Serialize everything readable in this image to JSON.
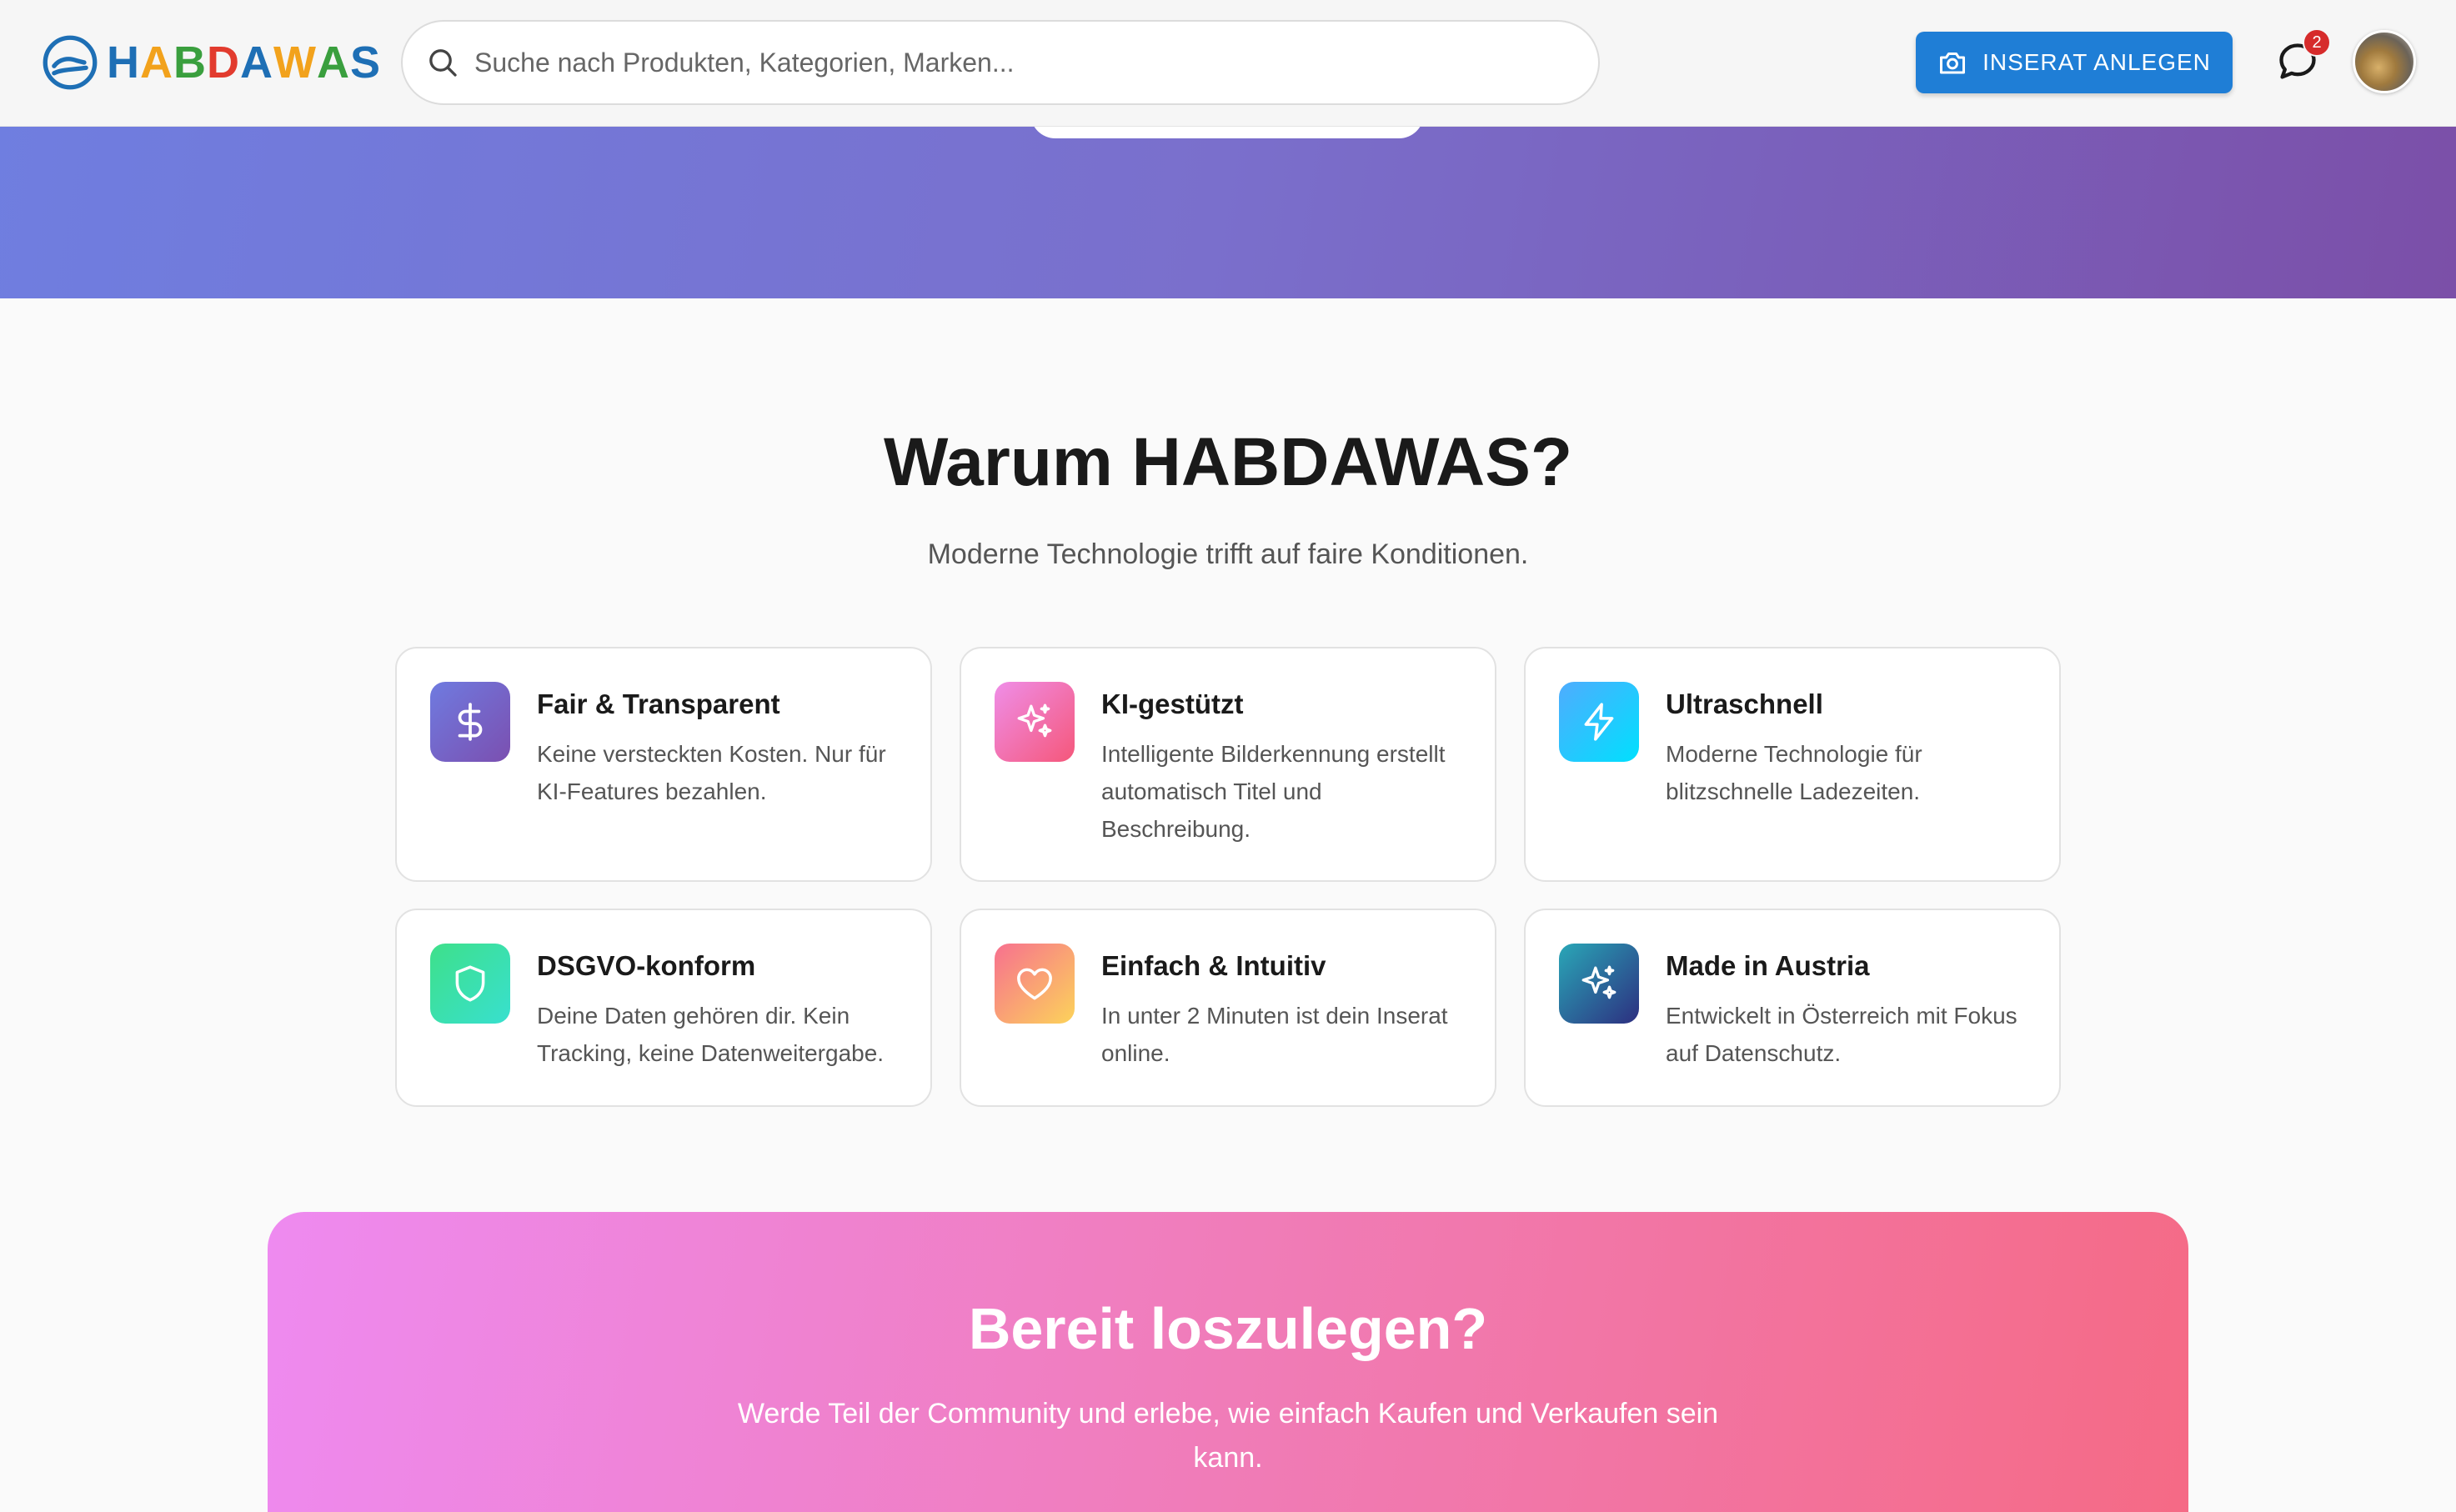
{
  "brand": {
    "letters": [
      "H",
      "A",
      "B",
      "D",
      "A",
      "W",
      "A",
      "S"
    ],
    "letter_colors": [
      "#1e6fb5",
      "#f2a21c",
      "#3a9f3e",
      "#e23b2e",
      "#1e6fb5",
      "#f2a21c",
      "#3a9f3e",
      "#1e6fb5"
    ],
    "mark_color": "#1e6fb5"
  },
  "search": {
    "placeholder": "Suche nach Produkten, Kategorien, Marken...",
    "icon": "search-icon"
  },
  "header": {
    "create_listing_label": "INSERAT ANLEGEN",
    "create_listing_icon": "camera-icon",
    "messages_icon": "chat-bubble-icon",
    "messages_badge": "2"
  },
  "features": {
    "title": "Warum HABDAWAS?",
    "subtitle": "Moderne Technologie trifft auf faire Konditionen.",
    "items": [
      {
        "title": "Fair & Transparent",
        "text": "Keine versteckten Kosten. Nur für KI-Features bezahlen.",
        "icon": "dollar-icon",
        "gradient": [
          "#6f7be0",
          "#7b4fb0"
        ]
      },
      {
        "title": "KI-gestützt",
        "text": "Intelligente Bilderkennung erstellt automatisch Titel und Beschreibung.",
        "icon": "sparkles-icon",
        "gradient": [
          "#ef8ee8",
          "#f5577a"
        ]
      },
      {
        "title": "Ultraschnell",
        "text": "Moderne Technologie für blitzschnelle Ladezeiten.",
        "icon": "lightning-icon",
        "gradient": [
          "#4facfe",
          "#00e0fe"
        ]
      },
      {
        "title": "DSGVO-konform",
        "text": "Deine Daten gehören dir. Kein Tracking, keine Datenweitergabe.",
        "icon": "shield-icon",
        "gradient": [
          "#3ee08a",
          "#38e0cf"
        ]
      },
      {
        "title": "Einfach & Intuitiv",
        "text": "In unter 2 Minuten ist dein Inserat online.",
        "icon": "heart-icon",
        "gradient": [
          "#f7708f",
          "#fcd35a"
        ]
      },
      {
        "title": "Made in Austria",
        "text": "Entwickelt in Österreich mit Fokus auf Datenschutz.",
        "icon": "sparkles-icon",
        "gradient": [
          "#29a7b7",
          "#2d2f80"
        ]
      }
    ]
  },
  "cta": {
    "title": "Bereit loszulegen?",
    "text": "Werde Teil der Community und erlebe, wie einfach Kaufen und Verkaufen sein kann."
  },
  "colors": {
    "primary": "#1f7ed6",
    "badge": "#d62b2b",
    "hero_gradient": [
      "#6f7ee0",
      "#7b4fa8"
    ],
    "cta_gradient": [
      "#ee8af0",
      "#f56a85"
    ]
  }
}
